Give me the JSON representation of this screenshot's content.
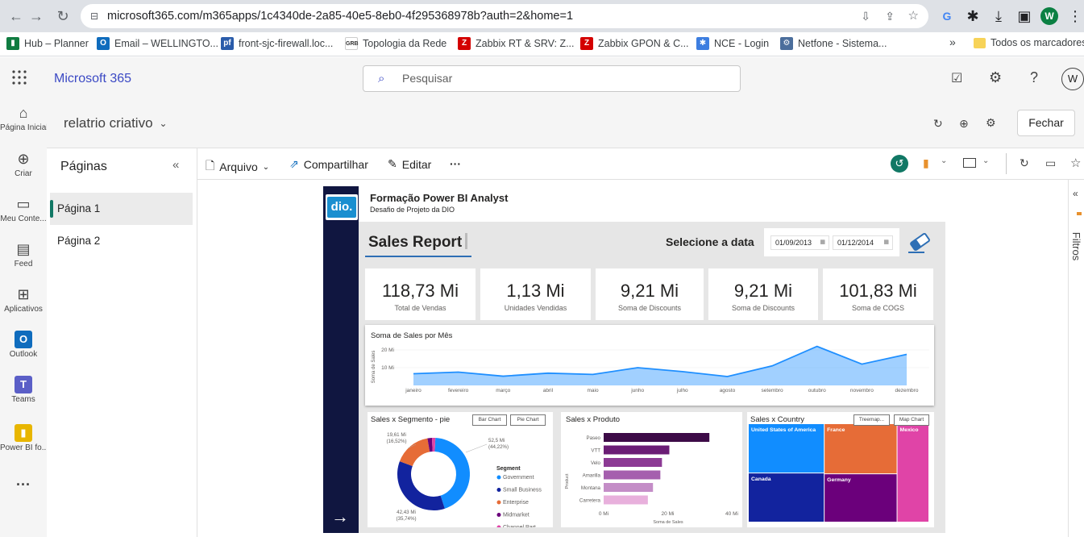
{
  "browser": {
    "url": "microsoft365.com/m365apps/1c4340de-2a85-40e5-8eb0-4f295368978b?auth=2&home=1",
    "profile_initial": "W",
    "bookmarks": [
      {
        "label": "Hub – Planner",
        "icon_color": "#107c41",
        "icon_text": "▮"
      },
      {
        "label": "Email – WELLINGTO...",
        "icon_color": "#0f6cbd",
        "icon_text": "O"
      },
      {
        "label": "front-sjc-firewall.loc...",
        "icon_color": "#2a5caa",
        "icon_text": "pf"
      },
      {
        "label": "Topologia da Rede",
        "icon_color": "#ffffff",
        "icon_text": "GRB"
      },
      {
        "label": "Zabbix RT & SRV: Z...",
        "icon_color": "#d40000",
        "icon_text": "Z"
      },
      {
        "label": "Zabbix GPON & C...",
        "icon_color": "#d40000",
        "icon_text": "Z"
      },
      {
        "label": "NCE - Login",
        "icon_color": "#3d7ee0",
        "icon_text": "✱"
      },
      {
        "label": "Netfone - Sistema...",
        "icon_color": "#4b6e9c",
        "icon_text": "⚙"
      }
    ],
    "more_bookmarks": "»",
    "all_bookmarks": "Todos os marcadores"
  },
  "m365": {
    "app_name": "Microsoft 365",
    "search_placeholder": "Pesquisar",
    "avatar": "W",
    "rail": [
      {
        "label": "Página Inicial",
        "icon": "home-icon"
      },
      {
        "label": "Criar",
        "icon": "create-icon"
      },
      {
        "label": "Meu Conte...",
        "icon": "folder-icon"
      },
      {
        "label": "Feed",
        "icon": "feed-icon"
      },
      {
        "label": "Aplicativos",
        "icon": "apps-icon"
      },
      {
        "label": "Outlook",
        "icon": "outlook-icon"
      },
      {
        "label": "Teams",
        "icon": "teams-icon"
      },
      {
        "label": "Power BI fo...",
        "icon": "powerbi-icon"
      }
    ],
    "more": "···"
  },
  "report_header": {
    "title": "relatrio criativo",
    "close_label": "Fechar"
  },
  "pages_pane": {
    "title": "Páginas",
    "pages": [
      "Página 1",
      "Página 2"
    ],
    "active": "Página 1"
  },
  "toolbar": {
    "file": "Arquivo",
    "share": "Compartilhar",
    "edit": "Editar",
    "more": "···"
  },
  "filters_label": "Filtros",
  "report": {
    "logo": "dio.",
    "heading": "Formação Power BI Analyst",
    "subheading": "Desafio de Projeto da DIO",
    "title": "Sales Report",
    "date_prompt": "Selecione a data",
    "date_from": "01/09/2013",
    "date_to": "01/12/2014",
    "kpis": [
      {
        "value": "118,73 Mi",
        "label": "Total de Vendas"
      },
      {
        "value": "1,13 Mi",
        "label": "Unidades Vendidas"
      },
      {
        "value": "9,21 Mi",
        "label": "Soma de Discounts"
      },
      {
        "value": "9,21 Mi",
        "label": "Soma de Discounts"
      },
      {
        "value": "101,83 Mi",
        "label": "Soma de COGS"
      }
    ],
    "pie_title": "Sales x Segmento - pie",
    "pie_buttons": [
      "Bar Chart",
      "Pie Chart"
    ],
    "product_title": "Sales x Produto",
    "country_title": "Sales x Country",
    "country_buttons": [
      "Treemap...",
      "Map Chart"
    ]
  },
  "chart_data": [
    {
      "type": "area",
      "title": "Soma de Sales por Mês",
      "ylabel": "Soma de Sales",
      "categories": [
        "janeiro",
        "fevereiro",
        "março",
        "abril",
        "maio",
        "junho",
        "julho",
        "agosto",
        "setembro",
        "outubro",
        "novembro",
        "dezembro"
      ],
      "values": [
        6.6,
        7.5,
        5.2,
        6.9,
        6.2,
        10.0,
        7.8,
        5.0,
        11.0,
        22.0,
        12.0,
        17.5
      ],
      "yticks": [
        "10 Mi",
        "20 Mi"
      ],
      "ylim": [
        0,
        25
      ],
      "color": "#1f8fff"
    },
    {
      "type": "pie",
      "title": "Sales x Segmento - pie",
      "legend_title": "Segment",
      "categories": [
        "Government",
        "Small Business",
        "Enterprise",
        "Midmarket",
        "Channel Part..."
      ],
      "values": [
        52.5,
        42.43,
        19.61,
        2.38,
        1.8
      ],
      "colors": [
        "#118dff",
        "#12239e",
        "#e66c37",
        "#6b007b",
        "#e044a7"
      ],
      "data_labels": [
        {
          "value": "52,5 Mi",
          "pct": "(44,22%)"
        },
        {
          "value": "42,43 Mi",
          "pct": "(35,74%)"
        },
        {
          "value": "19,61 Mi",
          "pct": "(16,52%)"
        }
      ]
    },
    {
      "type": "bar",
      "title": "Sales x Produto",
      "xlabel": "Soma de Sales",
      "ylabel": "Product",
      "categories": [
        "Paseo",
        "VTT",
        "Velo",
        "Amarilla",
        "Montana",
        "Carretera"
      ],
      "values": [
        33.0,
        20.5,
        18.2,
        17.7,
        15.4,
        13.8
      ],
      "xticks": [
        "0 Mi",
        "20 Mi",
        "40 Mi"
      ],
      "xlim": [
        0,
        40
      ],
      "colors": [
        "#3d0b47",
        "#6b1d75",
        "#8c3a94",
        "#a55fae",
        "#c48dc7",
        "#e8b0dc"
      ]
    },
    {
      "type": "treemap",
      "title": "Sales x Country",
      "categories": [
        "United States of America",
        "France",
        "Mexico",
        "Canada",
        "Germany"
      ],
      "values": [
        25.0,
        24.4,
        20.9,
        24.9,
        23.5
      ],
      "colors": [
        "#118dff",
        "#e66c37",
        "#e044a7",
        "#12239e",
        "#6b007b"
      ]
    }
  ]
}
